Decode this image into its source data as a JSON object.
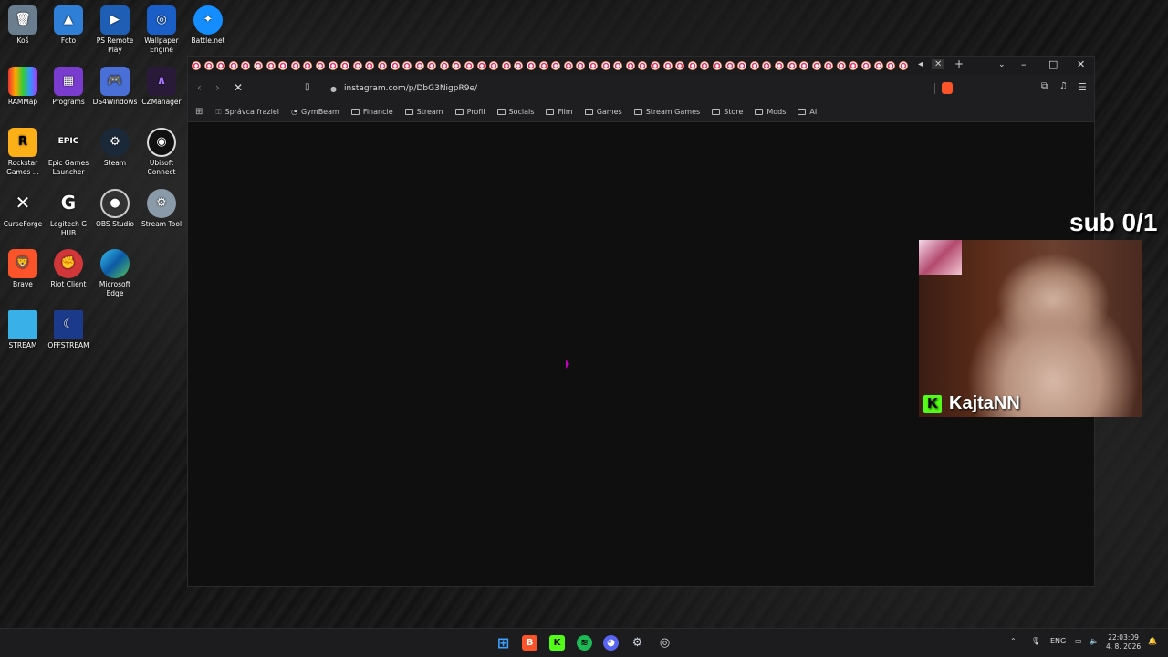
{
  "desktop": {
    "icons": [
      {
        "label": "Koš"
      },
      {
        "label": "Foto"
      },
      {
        "label": "PS Remote Play"
      },
      {
        "label": "Wallpaper Engine"
      },
      {
        "label": "Battle.net"
      },
      {
        "label": "RAMMap"
      },
      {
        "label": "Programs"
      },
      {
        "label": "DS4Windows"
      },
      {
        "label": "CZManager"
      },
      {
        "label": "Rockstar Games ..."
      },
      {
        "label": "Epic Games Launcher"
      },
      {
        "label": "Steam"
      },
      {
        "label": "Ubisoft Connect"
      },
      {
        "label": "CurseForge"
      },
      {
        "label": "Logitech G HUB"
      },
      {
        "label": "OBS Studio"
      },
      {
        "label": "Stream Tool"
      },
      {
        "label": "Brave"
      },
      {
        "label": "Riot Client"
      },
      {
        "label": "Microsoft Edge"
      },
      {
        "label": "STREAM"
      },
      {
        "label": "OFFSTREAM"
      }
    ]
  },
  "browser": {
    "url": "instagram.com/p/DbG3NigpR9e/",
    "bookmarks": [
      {
        "label": "Správca fraziel"
      },
      {
        "label": "GymBeam"
      },
      {
        "label": "Financie"
      },
      {
        "label": "Stream"
      },
      {
        "label": "Profil"
      },
      {
        "label": "Socials"
      },
      {
        "label": "Film"
      },
      {
        "label": "Games"
      },
      {
        "label": "Stream Games"
      },
      {
        "label": "Store"
      },
      {
        "label": "Mods"
      },
      {
        "label": "AI"
      }
    ]
  },
  "overlay": {
    "sub_counter": "sub 0/1",
    "streamer_name": "KajtaNN"
  },
  "taskbar": {
    "language": "ENG",
    "time": "22:03:09",
    "date": "4. 8. 2026"
  }
}
